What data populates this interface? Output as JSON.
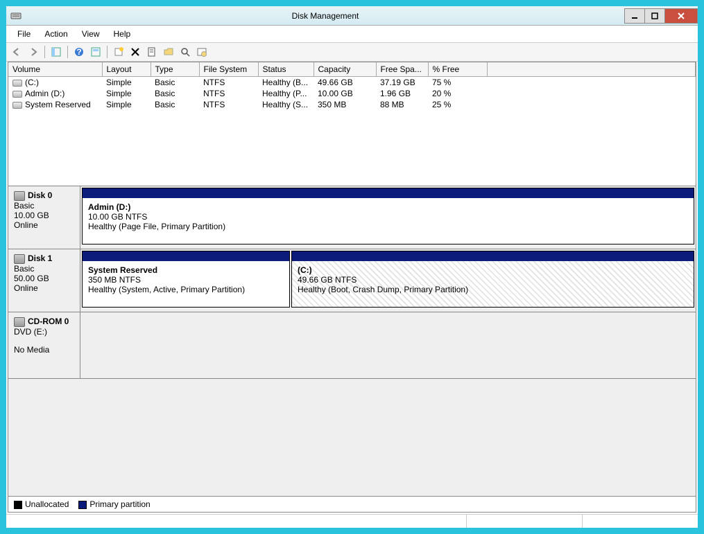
{
  "window": {
    "title": "Disk Management"
  },
  "menu": {
    "file": "File",
    "action": "Action",
    "view": "View",
    "help": "Help"
  },
  "columns": {
    "volume": "Volume",
    "layout": "Layout",
    "type": "Type",
    "fs": "File System",
    "status": "Status",
    "capacity": "Capacity",
    "free": "Free Spa...",
    "pct": "% Free"
  },
  "volumes": [
    {
      "name": "(C:)",
      "layout": "Simple",
      "type": "Basic",
      "fs": "NTFS",
      "status": "Healthy (B...",
      "capacity": "49.66 GB",
      "free": "37.19 GB",
      "pct": "75 %"
    },
    {
      "name": "Admin (D:)",
      "layout": "Simple",
      "type": "Basic",
      "fs": "NTFS",
      "status": "Healthy (P...",
      "capacity": "10.00 GB",
      "free": "1.96 GB",
      "pct": "20 %"
    },
    {
      "name": "System Reserved",
      "layout": "Simple",
      "type": "Basic",
      "fs": "NTFS",
      "status": "Healthy (S...",
      "capacity": "350 MB",
      "free": "88 MB",
      "pct": "25 %"
    }
  ],
  "disks": [
    {
      "title": "Disk 0",
      "type": "Basic",
      "size": "10.00 GB",
      "status": "Online",
      "partitions": [
        {
          "title": "Admin  (D:)",
          "line2": "10.00 GB NTFS",
          "line3": "Healthy (Page File, Primary Partition)",
          "hatched": false
        }
      ]
    },
    {
      "title": "Disk 1",
      "type": "Basic",
      "size": "50.00 GB",
      "status": "Online",
      "partitions": [
        {
          "title": "System Reserved",
          "line2": "350 MB NTFS",
          "line3": "Healthy (System, Active, Primary Partition)",
          "hatched": false
        },
        {
          "title": "(C:)",
          "line2": "49.66 GB NTFS",
          "line3": "Healthy (Boot, Crash Dump, Primary Partition)",
          "hatched": true
        }
      ]
    }
  ],
  "cdrom": {
    "title": "CD-ROM 0",
    "type": "DVD (E:)",
    "status": "No Media"
  },
  "legend": {
    "unallocated": "Unallocated",
    "primary": "Primary partition"
  }
}
